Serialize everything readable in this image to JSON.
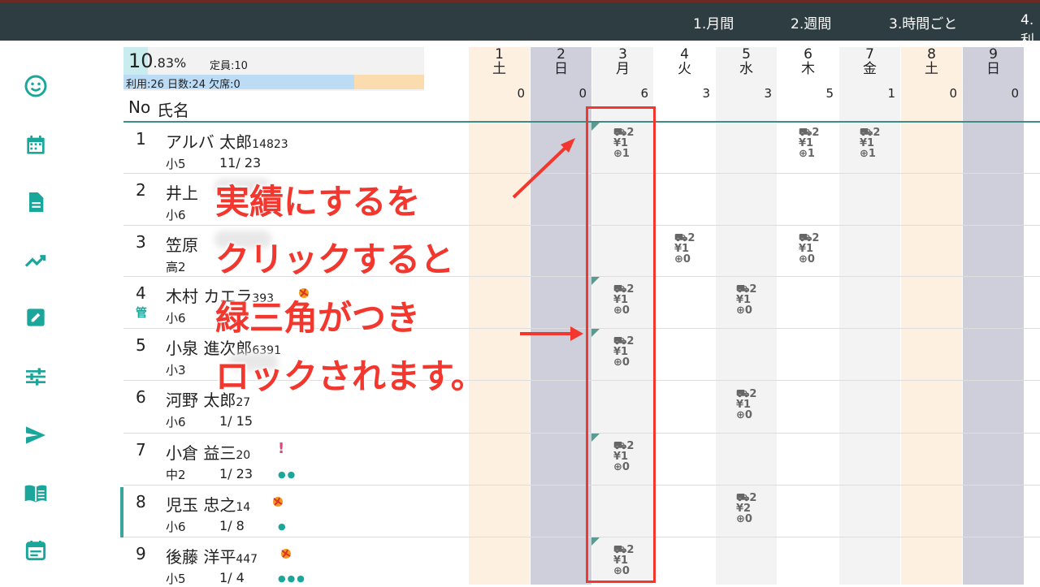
{
  "topbar": {
    "tabs": [
      "1.月間",
      "2.週間",
      "3.時間ごと",
      "4.利"
    ]
  },
  "sidebar": {
    "icons": [
      "face-icon",
      "calendar-icon",
      "document-icon",
      "trending-icon",
      "edit-icon",
      "sliders-icon",
      "send-icon",
      "book-icon",
      "event-note-icon"
    ]
  },
  "summary": {
    "rate_main": "10",
    "rate_decimal": ".83%",
    "capacity": "定員:10",
    "usage": "利用:26 日数:24 欠席:0"
  },
  "header": {
    "no": "No",
    "name": "氏名"
  },
  "days": [
    {
      "day": "1",
      "dow": "土",
      "count": "0"
    },
    {
      "day": "2",
      "dow": "日",
      "count": "0"
    },
    {
      "day": "3",
      "dow": "月",
      "count": "6"
    },
    {
      "day": "4",
      "dow": "火",
      "count": "3"
    },
    {
      "day": "5",
      "dow": "水",
      "count": "3"
    },
    {
      "day": "6",
      "dow": "木",
      "count": "5"
    },
    {
      "day": "7",
      "dow": "金",
      "count": "1"
    },
    {
      "day": "8",
      "dow": "土",
      "count": "0"
    },
    {
      "day": "9",
      "dow": "日",
      "count": "0"
    }
  ],
  "rows": [
    {
      "no": "1",
      "name": "アルバ 太郎",
      "id": "14823",
      "grade": "小5",
      "date": "11/ 23"
    },
    {
      "no": "2",
      "name": "井上",
      "id": "",
      "grade": "小6",
      "date": ""
    },
    {
      "no": "3",
      "name": "笠原",
      "id": "",
      "grade": "高2",
      "date": ""
    },
    {
      "no": "4",
      "name": "木村 カエラ",
      "id": "393",
      "grade": "小6",
      "date": "",
      "mgr": "管"
    },
    {
      "no": "5",
      "name": "小泉 進次郎",
      "id": "6391",
      "grade": "小3",
      "date": ""
    },
    {
      "no": "6",
      "name": "河野 太郎",
      "id": "27",
      "grade": "小6",
      "date": "1/ 15"
    },
    {
      "no": "7",
      "name": "小倉 益三",
      "id": "20",
      "grade": "中2",
      "date": "1/ 23",
      "excl": "!",
      "dots": "●●"
    },
    {
      "no": "8",
      "name": "児玉 忠之",
      "id": "14",
      "grade": "小6",
      "date": "1/  8",
      "dots": "●"
    },
    {
      "no": "9",
      "name": "後藤 洋平",
      "id": "447",
      "grade": "小5",
      "date": "1/  4",
      "dots": "●●●"
    }
  ],
  "cells": {
    "c_r1_d3": [
      "2",
      "1",
      "1"
    ],
    "c_r1_d6": [
      "2",
      "1",
      "1"
    ],
    "c_r1_d7": [
      "2",
      "1",
      "1"
    ],
    "c_r3_d4": [
      "2",
      "1",
      "0"
    ],
    "c_r3_d6": [
      "2",
      "1",
      "0"
    ],
    "c_r4_d3": [
      "2",
      "1",
      "0"
    ],
    "c_r4_d5": [
      "2",
      "1",
      "0"
    ],
    "c_r5_d3": [
      "2",
      "1",
      "0"
    ],
    "c_r6_d5": [
      "2",
      "1",
      "0"
    ],
    "c_r7_d3": [
      "2",
      "1",
      "0"
    ],
    "c_r8_d5": [
      "2",
      "2",
      "0"
    ],
    "c_r9_d3": [
      "2",
      "1",
      "0"
    ]
  },
  "annotation": {
    "line1": "実績にするを",
    "line2": "クリックすると",
    "line3": "緑三角がつき",
    "line4": "ロックされます。"
  },
  "colors": {
    "saturday_bg": "#fdf0e1",
    "sunday_bg": "#cfcfdc",
    "weekday_alt_bg": "#f3f3f3",
    "accent": "#1aa69b",
    "annotation_red": "#f2372e"
  }
}
